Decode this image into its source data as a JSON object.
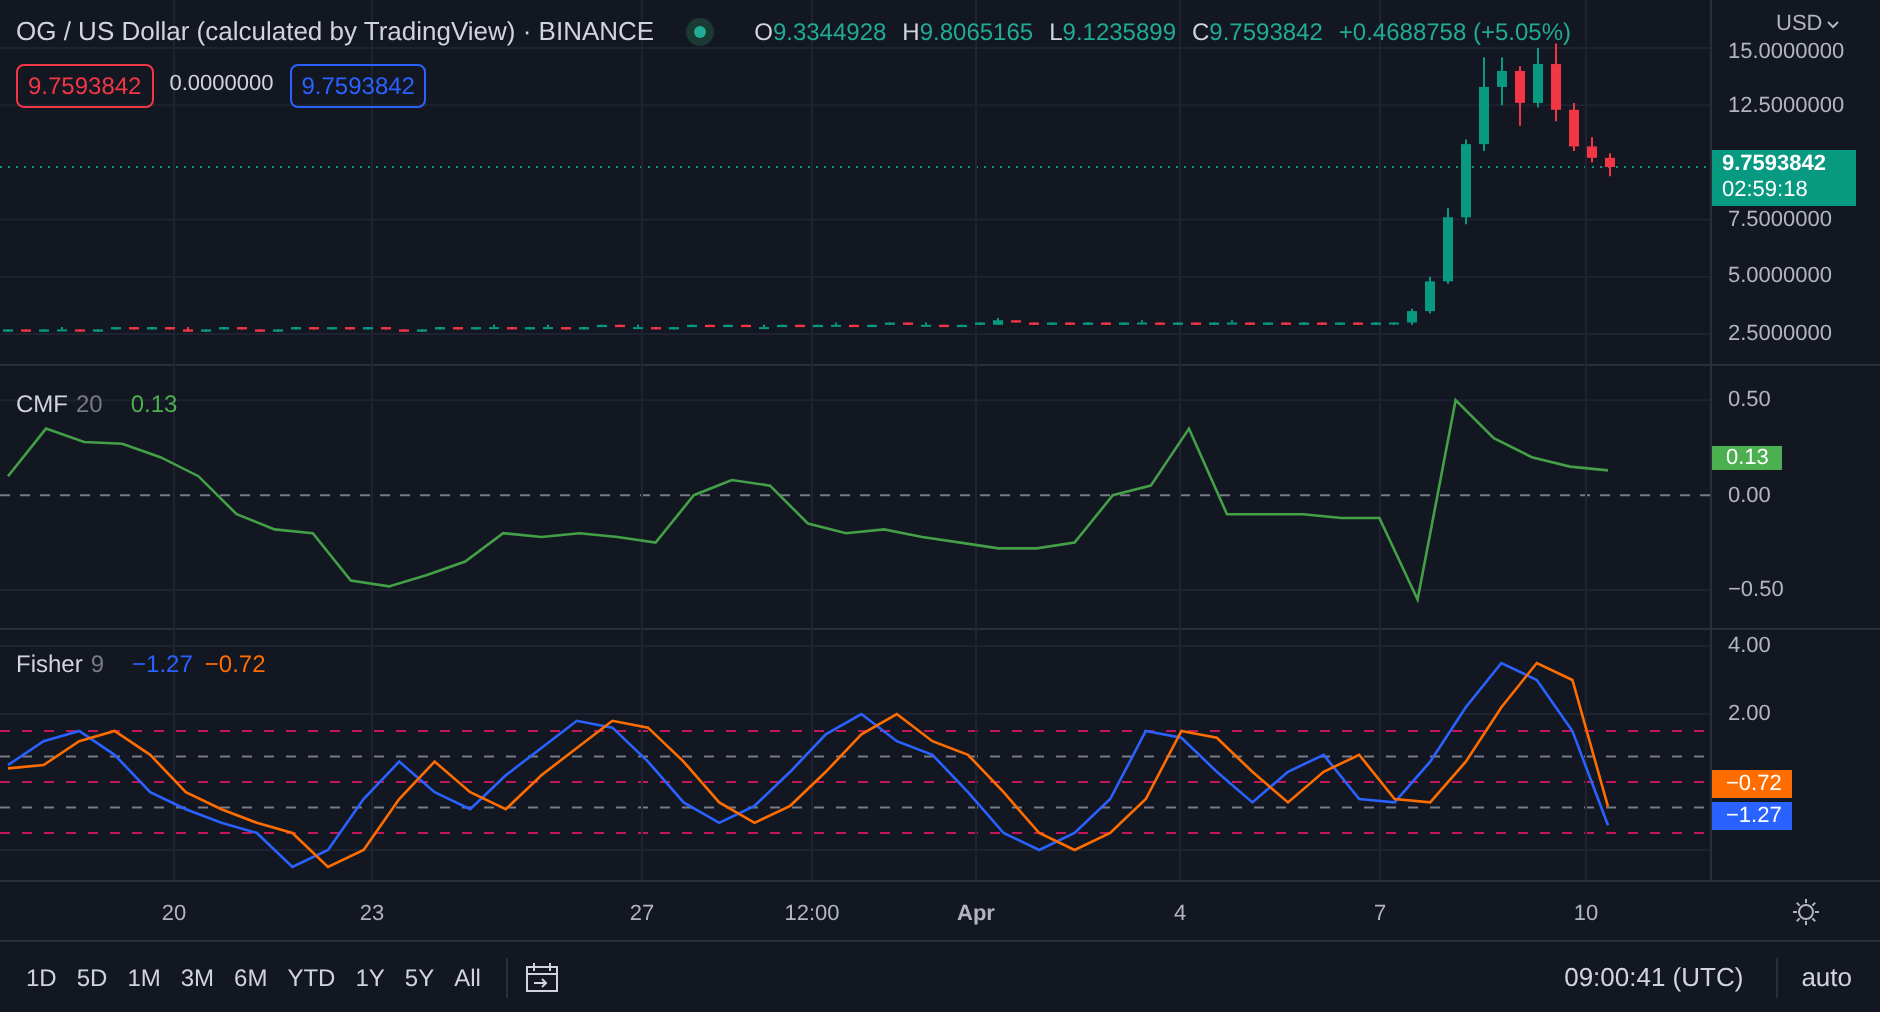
{
  "header": {
    "title": "OG / US Dollar (calculated by TradingView) · BINANCE",
    "live": true,
    "ohlc": [
      {
        "letter": "O",
        "value": "9.3344928"
      },
      {
        "letter": "H",
        "value": "9.8065165"
      },
      {
        "letter": "L",
        "value": "9.1235899"
      },
      {
        "letter": "C",
        "value": "9.7593842"
      }
    ],
    "change": "+0.4688758 (+5.05%)",
    "sell_price": "9.7593842",
    "spread": "0.0000000",
    "buy_price": "9.7593842"
  },
  "currency": "USD",
  "price_pane": {
    "last_price": "9.7593842",
    "countdown": "02:59:18",
    "chart_data": {
      "type": "candlestick",
      "grid": true,
      "ylim": [
        1.1,
        17.1
      ],
      "yticks": [
        {
          "value": 15,
          "label": "15.0000000"
        },
        {
          "value": 12.5,
          "label": "12.5000000"
        },
        {
          "value": 7.5,
          "label": "7.5000000"
        },
        {
          "value": 5,
          "label": "5.0000000"
        },
        {
          "value": 2.5,
          "label": "2.5000000"
        }
      ],
      "ohlc": [
        [
          2.6,
          2.7,
          2.6,
          2.7
        ],
        [
          2.7,
          2.7,
          2.6,
          2.6
        ],
        [
          2.6,
          2.7,
          2.6,
          2.7
        ],
        [
          2.7,
          2.8,
          2.7,
          2.7
        ],
        [
          2.7,
          2.7,
          2.6,
          2.6
        ],
        [
          2.6,
          2.7,
          2.6,
          2.7
        ],
        [
          2.7,
          2.8,
          2.7,
          2.8
        ],
        [
          2.8,
          2.8,
          2.7,
          2.7
        ],
        [
          2.7,
          2.8,
          2.7,
          2.8
        ],
        [
          2.8,
          2.8,
          2.7,
          2.7
        ],
        [
          2.7,
          2.8,
          2.6,
          2.6
        ],
        [
          2.6,
          2.7,
          2.6,
          2.7
        ],
        [
          2.7,
          2.8,
          2.7,
          2.8
        ],
        [
          2.8,
          2.8,
          2.7,
          2.7
        ],
        [
          2.7,
          2.7,
          2.6,
          2.6
        ],
        [
          2.6,
          2.7,
          2.6,
          2.7
        ],
        [
          2.7,
          2.8,
          2.7,
          2.8
        ],
        [
          2.8,
          2.8,
          2.7,
          2.7
        ],
        [
          2.7,
          2.8,
          2.7,
          2.8
        ],
        [
          2.8,
          2.8,
          2.7,
          2.7
        ],
        [
          2.7,
          2.8,
          2.7,
          2.8
        ],
        [
          2.8,
          2.8,
          2.7,
          2.7
        ],
        [
          2.7,
          2.7,
          2.6,
          2.6
        ],
        [
          2.6,
          2.7,
          2.6,
          2.7
        ],
        [
          2.7,
          2.8,
          2.7,
          2.8
        ],
        [
          2.8,
          2.8,
          2.7,
          2.7
        ],
        [
          2.7,
          2.8,
          2.7,
          2.8
        ],
        [
          2.8,
          2.9,
          2.8,
          2.8
        ],
        [
          2.8,
          2.8,
          2.7,
          2.7
        ],
        [
          2.7,
          2.8,
          2.7,
          2.8
        ],
        [
          2.8,
          2.9,
          2.8,
          2.8
        ],
        [
          2.8,
          2.8,
          2.7,
          2.7
        ],
        [
          2.7,
          2.8,
          2.7,
          2.8
        ],
        [
          2.8,
          2.9,
          2.8,
          2.9
        ],
        [
          2.9,
          2.9,
          2.8,
          2.8
        ],
        [
          2.8,
          2.9,
          2.8,
          2.8
        ],
        [
          2.8,
          2.8,
          2.7,
          2.7
        ],
        [
          2.7,
          2.8,
          2.7,
          2.8
        ],
        [
          2.8,
          2.9,
          2.8,
          2.9
        ],
        [
          2.9,
          2.9,
          2.8,
          2.8
        ],
        [
          2.8,
          2.9,
          2.8,
          2.9
        ],
        [
          2.9,
          2.9,
          2.8,
          2.8
        ],
        [
          2.8,
          2.9,
          2.8,
          2.8
        ],
        [
          2.8,
          2.9,
          2.8,
          2.9
        ],
        [
          2.9,
          2.9,
          2.8,
          2.8
        ],
        [
          2.8,
          2.9,
          2.8,
          2.9
        ],
        [
          2.9,
          3.0,
          2.9,
          2.9
        ],
        [
          2.9,
          2.9,
          2.8,
          2.8
        ],
        [
          2.8,
          2.9,
          2.8,
          2.9
        ],
        [
          2.9,
          3.0,
          2.9,
          3.0
        ],
        [
          3.0,
          3.0,
          2.9,
          2.9
        ],
        [
          2.9,
          3.0,
          2.9,
          2.9
        ],
        [
          2.9,
          2.9,
          2.8,
          2.8
        ],
        [
          2.8,
          2.9,
          2.8,
          2.9
        ],
        [
          2.9,
          3.0,
          2.9,
          3.0
        ],
        [
          2.9,
          3.2,
          2.9,
          3.1
        ],
        [
          3.1,
          3.1,
          3.0,
          3.0
        ],
        [
          3.0,
          3.0,
          2.9,
          2.9
        ],
        [
          2.9,
          3.0,
          2.9,
          3.0
        ],
        [
          3.0,
          3.0,
          2.9,
          2.9
        ],
        [
          2.9,
          3.0,
          2.9,
          3.0
        ],
        [
          3.0,
          3.0,
          2.9,
          2.9
        ],
        [
          2.9,
          3.0,
          2.9,
          3.0
        ],
        [
          3.0,
          3.1,
          3.0,
          3.0
        ],
        [
          3.0,
          3.0,
          2.9,
          2.9
        ],
        [
          2.9,
          3.0,
          2.9,
          3.0
        ],
        [
          3.0,
          3.0,
          2.9,
          2.9
        ],
        [
          2.9,
          3.0,
          2.9,
          3.0
        ],
        [
          3.0,
          3.1,
          3.0,
          3.0
        ],
        [
          3.0,
          3.0,
          2.9,
          2.9
        ],
        [
          2.9,
          3.0,
          2.9,
          3.0
        ],
        [
          3.0,
          3.0,
          2.9,
          2.9
        ],
        [
          2.9,
          3.0,
          2.9,
          3.0
        ],
        [
          3.0,
          3.0,
          2.9,
          2.9
        ],
        [
          2.9,
          3.0,
          2.9,
          3.0
        ],
        [
          3.0,
          3.0,
          2.9,
          2.9
        ],
        [
          2.9,
          3.0,
          2.9,
          3.0
        ],
        [
          3.0,
          3.0,
          2.9,
          3.0
        ],
        [
          3.0,
          3.6,
          2.9,
          3.5
        ],
        [
          3.5,
          5.0,
          3.4,
          4.8
        ],
        [
          4.8,
          8.0,
          4.7,
          7.6
        ],
        [
          7.6,
          11.0,
          7.3,
          10.8
        ],
        [
          10.8,
          14.6,
          10.5,
          13.3
        ],
        [
          13.3,
          14.6,
          12.5,
          14.0
        ],
        [
          14.0,
          14.2,
          11.6,
          12.6
        ],
        [
          12.6,
          15.0,
          12.4,
          14.3
        ],
        [
          14.3,
          15.2,
          11.8,
          12.3
        ],
        [
          12.3,
          12.6,
          10.5,
          10.7
        ],
        [
          10.7,
          11.1,
          10.0,
          10.2
        ],
        [
          10.2,
          10.4,
          9.4,
          9.8
        ]
      ]
    }
  },
  "cmf_pane": {
    "length": "20",
    "value": "0.13",
    "tag_value": "0.13",
    "chart_data": {
      "type": "line",
      "grid": true,
      "ylim": [
        -0.71,
        0.68
      ],
      "yticks": [
        {
          "value": 0.5,
          "label": "0.50"
        },
        {
          "value": 0,
          "label": "0.00"
        },
        {
          "value": -0.5,
          "label": "−0.50"
        }
      ],
      "series": [
        {
          "name": "CMF",
          "color": "#43a047",
          "values": [
            0.1,
            0.35,
            0.28,
            0.27,
            0.2,
            0.1,
            -0.1,
            -0.18,
            -0.2,
            -0.45,
            -0.48,
            -0.42,
            -0.35,
            -0.2,
            -0.22,
            -0.2,
            -0.22,
            -0.25,
            0.0,
            0.08,
            0.05,
            -0.15,
            -0.2,
            -0.18,
            -0.22,
            -0.25,
            -0.28,
            -0.28,
            -0.25,
            0.0,
            0.05,
            0.35,
            -0.1,
            -0.1,
            -0.1,
            -0.12,
            -0.12,
            -0.55,
            0.5,
            0.3,
            0.2,
            0.15,
            0.13
          ]
        }
      ]
    }
  },
  "fisher_pane": {
    "length": "9",
    "fisher_value": "−1.27",
    "trigger_value": "−0.72",
    "fisher_tag": "−1.27",
    "trigger_tag": "−0.72",
    "chart_data": {
      "type": "line",
      "grid": true,
      "ylim": [
        -2.88,
        4.47
      ],
      "yticks": [
        {
          "value": 4,
          "label": "4.00"
        },
        {
          "value": 2,
          "label": "2.00"
        }
      ],
      "series": [
        {
          "name": "Fisher",
          "color": "#2962ff",
          "values": [
            0.5,
            1.2,
            1.5,
            0.8,
            -0.3,
            -0.8,
            -1.2,
            -1.5,
            -2.5,
            -2.0,
            -0.5,
            0.6,
            -0.3,
            -0.8,
            0.2,
            1.0,
            1.8,
            1.6,
            0.6,
            -0.6,
            -1.2,
            -0.7,
            0.3,
            1.4,
            2.0,
            1.2,
            0.8,
            -0.3,
            -1.5,
            -2.0,
            -1.5,
            -0.5,
            1.5,
            1.3,
            0.3,
            -0.6,
            0.3,
            0.8,
            -0.5,
            -0.6,
            0.6,
            2.2,
            3.5,
            3.0,
            1.5,
            -1.27
          ]
        },
        {
          "color": "#ff6d00",
          "values": [
            0.4,
            0.5,
            1.2,
            1.5,
            0.8,
            -0.3,
            -0.8,
            -1.2,
            -1.5,
            -2.5,
            -2.0,
            -0.5,
            0.6,
            -0.3,
            -0.8,
            0.2,
            1.0,
            1.8,
            1.6,
            0.6,
            -0.6,
            -1.2,
            -0.7,
            0.3,
            1.4,
            2.0,
            1.2,
            0.8,
            -0.3,
            -1.5,
            -2.0,
            -1.5,
            -0.5,
            1.5,
            1.3,
            0.3,
            -0.6,
            0.3,
            0.8,
            -0.5,
            -0.6,
            0.6,
            2.2,
            3.5,
            3.0,
            -0.72
          ]
        }
      ]
    }
  },
  "time_axis": [
    "20",
    "23",
    "27",
    "12:00",
    "Apr",
    "4",
    "7",
    "10"
  ],
  "ranges": [
    "1D",
    "5D",
    "1M",
    "3M",
    "6M",
    "YTD",
    "1Y",
    "5Y",
    "All"
  ],
  "clock": "09:00:41 (UTC)",
  "scale_mode": "auto"
}
